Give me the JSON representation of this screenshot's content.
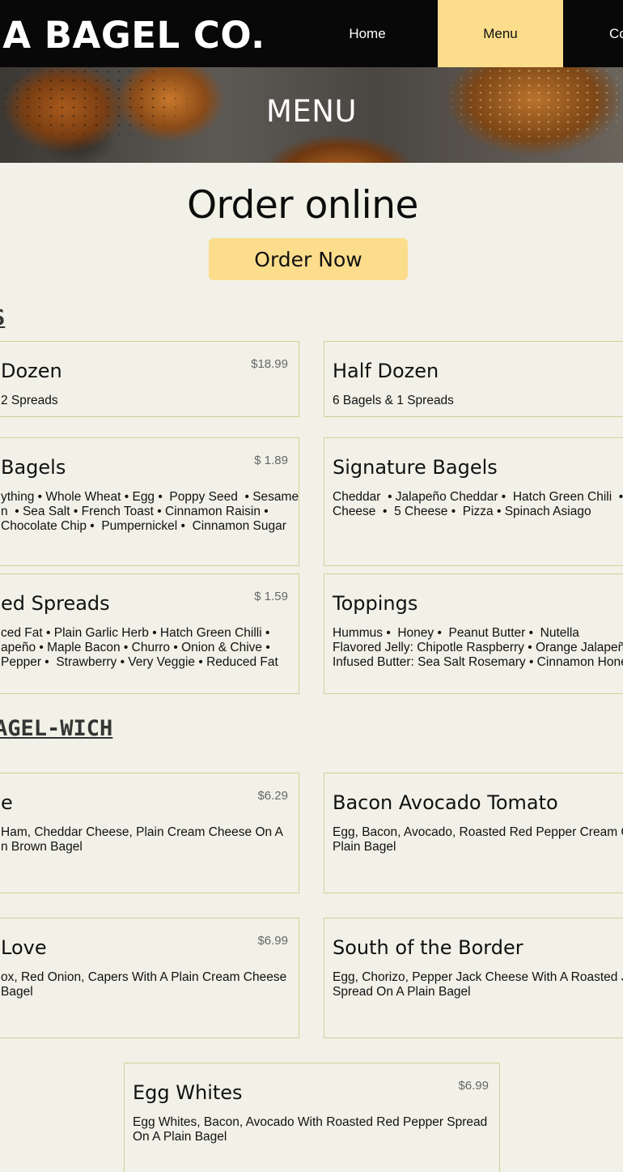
{
  "header": {
    "brand": "IA BAGEL CO.",
    "nav": [
      {
        "label": "Home"
      },
      {
        "label": "Menu"
      },
      {
        "label": "Co"
      }
    ]
  },
  "hero": {
    "title": "MENU"
  },
  "order": {
    "title": "Order online",
    "button_label": "Order Now"
  },
  "sections": {
    "bagels_heading": "S",
    "bagelwich_heading": "AGEL-WICH"
  },
  "bagel_cards": [
    {
      "title": "Dozen",
      "price": "$18.99",
      "desc": "2 Spreads"
    },
    {
      "title": "Half Dozen",
      "price": "",
      "desc": "6 Bagels & 1 Spreads"
    },
    {
      "title": "Bagels",
      "price": "$ 1.89",
      "desc": "ything • Whole Wheat • Egg •  Poppy Seed  • Sesame\nn  • Sea Salt • French Toast • Cinnamon Raisin •\nChocolate Chip •  Pumpernickel •  Cinnamon Sugar"
    },
    {
      "title": "Signature Bagels",
      "price": "",
      "desc": "Cheddar  • Jalapeño Cheddar •  Hatch Green Chili  • A\nCheese  •  5 Cheese •  Pizza • Spinach Asiago"
    },
    {
      "title": "ed Spreads",
      "price": "$ 1.59",
      "desc": "ced Fat • Plain Garlic Herb • Hatch Green Chilli •\napeño • Maple Bacon • Churro • Onion & Chive •\nPepper •  Strawberry • Very Veggie • Reduced Fat"
    },
    {
      "title": "Toppings",
      "price": "",
      "desc": "Hummus •  Honey •  Peanut Butter •  Nutella\nFlavored Jelly: Chipotle Raspberry • Orange Jalapeño\nInfused Butter: Sea Salt Rosemary • Cinnamon Honey"
    }
  ],
  "wich_cards": [
    {
      "title": "e",
      "price": "$6.29",
      "desc": "Ham, Cheddar Cheese, Plain Cream Cheese On A\nn Brown Bagel"
    },
    {
      "title": "Bacon Avocado Tomato",
      "price": "",
      "desc": "Egg, Bacon, Avocado, Roasted Red Pepper Cream Ch\nPlain Bagel"
    },
    {
      "title": "Love",
      "price": "$6.99",
      "desc": "ox, Red Onion, Capers With A Plain Cream Cheese\nBagel"
    },
    {
      "title": "South of the Border",
      "price": "",
      "desc": "Egg, Chorizo, Pepper Jack Cheese With A Roasted Jala\nSpread On A Plain Bagel"
    },
    {
      "title": "Egg Whites",
      "price": "$6.99",
      "desc": "Egg Whites, Bacon, Avocado With Roasted Red Pepper Spread\nOn A Plain Bagel"
    }
  ]
}
